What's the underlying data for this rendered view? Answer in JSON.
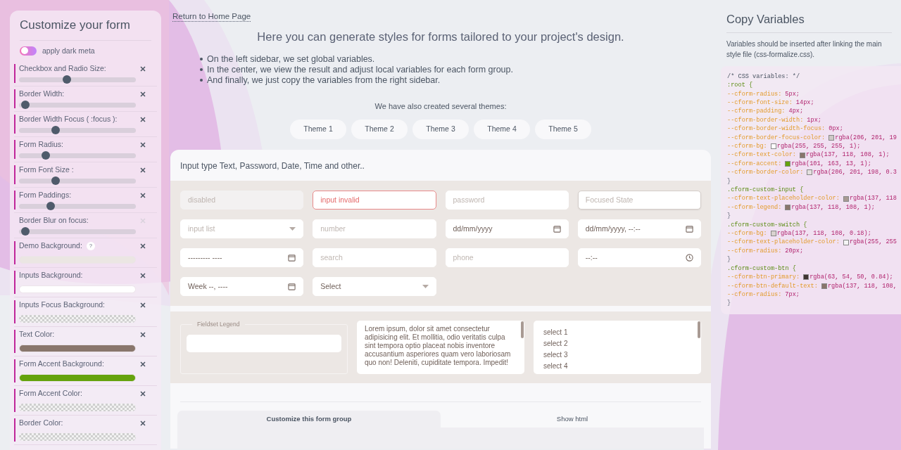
{
  "sidebar": {
    "title": "Customize your form",
    "dark_toggle": {
      "label": "apply dark meta",
      "on": false
    },
    "items": [
      {
        "kind": "slider",
        "label": "Checkbox and Radio Size:",
        "level": 0.4,
        "modified": true
      },
      {
        "kind": "slider",
        "label": "Border Width:",
        "level": 0.02,
        "modified": true
      },
      {
        "kind": "slider",
        "label": "Border Width Focus ( :focus ):",
        "level": 0.3,
        "modified": true
      },
      {
        "kind": "slider",
        "label": "Form Radius:",
        "level": 0.21,
        "modified": true
      },
      {
        "kind": "slider",
        "label": "Form Font Size :",
        "level": 0.3,
        "modified": true
      },
      {
        "kind": "slider",
        "label": "Form Paddings:",
        "level": 0.25,
        "modified": true
      },
      {
        "kind": "slider",
        "label": "Border Blur on focus:",
        "level": 0.02,
        "modified": false
      },
      {
        "kind": "color",
        "label": "Demo Background:",
        "help": "?",
        "color": "#ebe6e3",
        "modified": true
      },
      {
        "kind": "color",
        "label": "Inputs Background:",
        "color": "#ffffff",
        "modified": true
      },
      {
        "kind": "transparent",
        "label": "Inputs Focus Background:",
        "modified": true
      },
      {
        "kind": "color",
        "label": "Text Color:",
        "color": "#89766c",
        "modified": true
      },
      {
        "kind": "color",
        "label": "Form Accent Background:",
        "color": "#65a30d",
        "modified": true
      },
      {
        "kind": "transparent",
        "label": "Form Accent Color:",
        "modified": true
      },
      {
        "kind": "transparent",
        "label": "Border Color:",
        "modified": true
      }
    ]
  },
  "main": {
    "back_link": "Return to Home Page",
    "heading": "Here you can generate styles for forms tailored to your project's design.",
    "bullets": [
      "On the left sidebar, we set global variables.",
      "In the center, we view the result and adjust local variables for each form group.",
      "And finally, we just copy the variables from the right sidebar."
    ],
    "themes_intro": "We have also created several themes:",
    "themes": [
      "Theme 1",
      "Theme 2",
      "Theme 3",
      "Theme 4",
      "Theme 5"
    ],
    "form_group": {
      "title": "Input type Text, Password, Date, Time and other..",
      "fields": [
        {
          "kind": "text",
          "placeholder": "disabled",
          "disabled": true,
          "invalid": false,
          "focused": false
        },
        {
          "kind": "text",
          "placeholder": "input invalid",
          "disabled": false,
          "invalid": true,
          "focused": false
        },
        {
          "kind": "text",
          "placeholder": "password",
          "disabled": false,
          "invalid": false,
          "focused": false
        },
        {
          "kind": "text",
          "placeholder": "Focused State",
          "disabled": false,
          "invalid": false,
          "focused": true
        },
        {
          "kind": "datalist",
          "placeholder": "input list",
          "disabled": false,
          "invalid": false,
          "focused": false
        },
        {
          "kind": "text",
          "placeholder": "number",
          "disabled": false,
          "invalid": false,
          "focused": false
        },
        {
          "kind": "date",
          "value": "dd/mm/yyyy",
          "disabled": false,
          "invalid": false,
          "focused": false
        },
        {
          "kind": "date",
          "value": "dd/mm/yyyy, --:--",
          "disabled": false,
          "invalid": false,
          "focused": false
        },
        {
          "kind": "date",
          "value": "--------- ----",
          "disabled": false,
          "invalid": false,
          "focused": false
        },
        {
          "kind": "text",
          "placeholder": "search",
          "disabled": false,
          "invalid": false,
          "focused": false
        },
        {
          "kind": "text",
          "placeholder": "phone",
          "disabled": false,
          "invalid": false,
          "focused": false
        },
        {
          "kind": "time",
          "value": "--:--",
          "disabled": false,
          "invalid": false,
          "focused": false
        },
        {
          "kind": "date",
          "value": "Week --, ----",
          "disabled": false,
          "invalid": false,
          "focused": false
        },
        {
          "kind": "select",
          "value": "Select",
          "disabled": false,
          "invalid": false,
          "focused": false
        }
      ],
      "fieldset_legend": "Fieldset Legend",
      "textarea": "Lorem ipsum, dolor sit amet consectetur adipisicing elit. Et mollitia, odio veritatis culpa sint tempora optio placeat nobis inventore accusantium asperiores quam vero laboriosam quo non! Deleniti, cupiditate tempora. Impedit!",
      "list_options": [
        "select 1",
        "select 2",
        "select 3",
        "select 4"
      ]
    },
    "tabs": [
      {
        "label": "Customize this form group",
        "selected": true
      },
      {
        "label": "Show html",
        "selected": false
      }
    ]
  },
  "right": {
    "title": "Copy Variables",
    "note": "Variables should be inserted after linking the main style file (css-formalize.css).",
    "code": [
      {
        "kind": "comment",
        "text": "/* CSS variables: */"
      },
      {
        "kind": "selector",
        "text": ":root {"
      },
      {
        "kind": "decl",
        "prop": "--cform-radius:",
        "value": "5px;"
      },
      {
        "kind": "decl",
        "prop": "--cform-font-size:",
        "value": "14px;"
      },
      {
        "kind": "decl",
        "prop": "--cform-padding:",
        "value": "4px;"
      },
      {
        "kind": "decl",
        "prop": "--cform-border-width:",
        "value": "1px;"
      },
      {
        "kind": "decl",
        "prop": "--cform-border-width-focus:",
        "value": "0px;"
      },
      {
        "kind": "decl",
        "prop": "--cform-border-focus-color:",
        "color": "#cec9c6",
        "value": "rgba(206, 201, 19"
      },
      {
        "kind": "decl",
        "prop": "--cform-bg:",
        "color": "#ffffff",
        "value": "rgba(255, 255, 255, 1);"
      },
      {
        "kind": "decl",
        "prop": "--cform-text-color:",
        "color": "#89766c",
        "value": "rgba(137, 118, 108, 1);"
      },
      {
        "kind": "decl",
        "prop": "--cform-accent:",
        "color": "#65a30d",
        "value": "rgba(101, 163, 13, 1);"
      },
      {
        "kind": "decl",
        "prop": "--cform-border-color:",
        "color": "#e4e0de",
        "value": "rgba(206, 201, 198, 0.3"
      },
      {
        "kind": "close",
        "text": "}"
      },
      {
        "kind": "selector",
        "text": ".cform-custom-input {"
      },
      {
        "kind": "decl",
        "prop": "--cform-text-placeholder-color:",
        "color": "#a89a93",
        "value": "rgba(137, 118"
      },
      {
        "kind": "decl",
        "prop": "--cform-legend:",
        "color": "#89766c",
        "value": "rgba(137, 118, 108, 1);"
      },
      {
        "kind": "close",
        "text": "}"
      },
      {
        "kind": "selector",
        "text": ".cform-custom-switch {"
      },
      {
        "kind": "decl",
        "prop": "--cform-bg:",
        "color": "#d9d2ce",
        "value": "rgba(137, 118, 108, 0.18);"
      },
      {
        "kind": "decl",
        "prop": "--cform-text-placeholder-color:",
        "color": "#f5f5f5",
        "value": "rgba(255, 255"
      },
      {
        "kind": "decl",
        "prop": "--cform-radius:",
        "value": "20px;"
      },
      {
        "kind": "close",
        "text": "}"
      },
      {
        "kind": "selector",
        "text": ".cform-custom-btn {"
      },
      {
        "kind": "decl",
        "prop": "--cform-btn-primary:",
        "color": "#3f3632",
        "value": "rgba(63, 54, 50, 0.84);"
      },
      {
        "kind": "decl",
        "prop": "--cform-btn-default-text:",
        "color": "#89766c",
        "value": "rgba(137, 118, 108,"
      },
      {
        "kind": "decl",
        "prop": "--cform-radius:",
        "value": "7px;"
      },
      {
        "kind": "close",
        "text": "}"
      }
    ]
  }
}
